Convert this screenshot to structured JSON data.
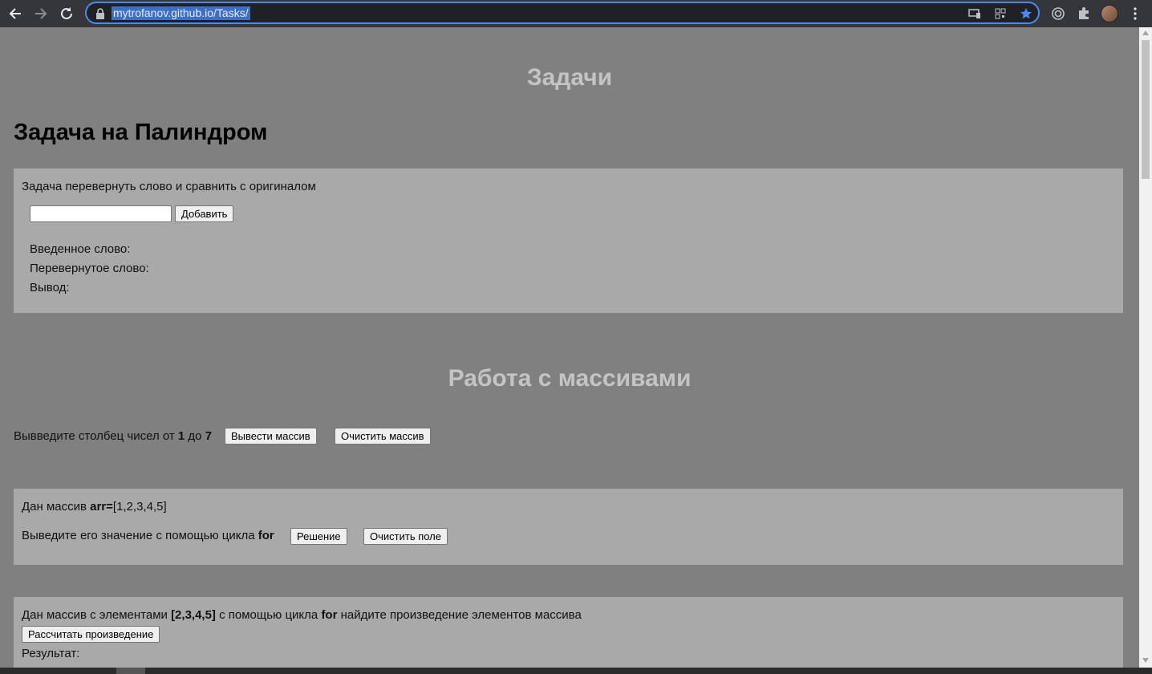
{
  "browser": {
    "url": "mytrofanov.github.io/Tasks/",
    "icons": [
      "back-arrow-icon",
      "forward-arrow-icon",
      "reload-icon",
      "lock-icon",
      "cast-icon",
      "qr-icon",
      "star-icon",
      "target-icon",
      "puzzle-icon",
      "avatar",
      "menu-dots-icon"
    ],
    "accent": "#4a8af4"
  },
  "page": {
    "main_title": "Задачи",
    "palindrome": {
      "title": "Задача на Палиндром",
      "description": "Задача перевернуть слово и сравнить с оригиналом",
      "input_value": "",
      "add_button": "Добавить",
      "entered_label": "Введенное слово:",
      "reversed_label": "Перевернутое слово:",
      "output_label": "Вывод:"
    },
    "arrays": {
      "title": "Работа с массивами",
      "column": {
        "text_prefix": "Вывведите столбец чисел от ",
        "num1": "1",
        "text_mid": " до ",
        "num2": "7",
        "show_button": "Вывести массив",
        "clear_button": "Очистить массив"
      },
      "loop": {
        "given_prefix": "Дан массив ",
        "given_code": "arr=",
        "given_array": "[1,2,3,4,5]",
        "prompt_prefix": "Выведите его значение с помощью цикла ",
        "prompt_code": "for",
        "solve_button": "Решение",
        "clear_button": "Очистить поле"
      },
      "product": {
        "text_prefix": "Дан массив с элементами ",
        "array": "[2,3,4,5]",
        "text_mid": " с помощью цикла ",
        "code": "for",
        "text_suffix": " найдите произведение элементов массива",
        "calc_button": "Рассчитать произведение",
        "result_label": "Результат:"
      }
    }
  },
  "colors": {
    "page_bg": "#808080",
    "panel_bg": "#a9a9a9",
    "heading_gray": "#c4c4c4"
  }
}
